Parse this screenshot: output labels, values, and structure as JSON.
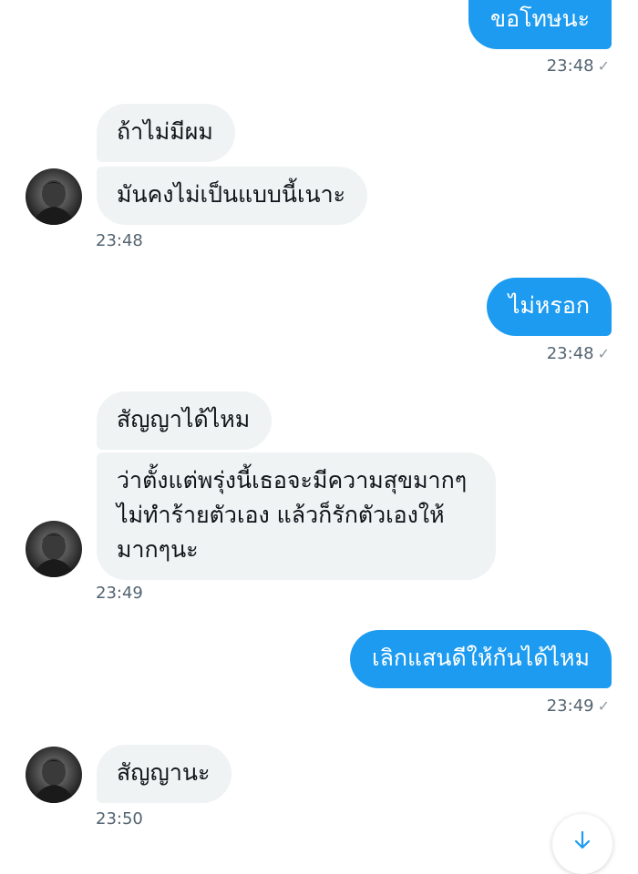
{
  "conversation": {
    "messages": [
      {
        "direction": "outgoing",
        "text": "ขอโทษนะ",
        "time": "23:48",
        "status_icon": "check-icon"
      },
      {
        "direction": "incoming",
        "lines": [
          "ถ้าไม่มีผม",
          "มันคงไม่เป็นแบบนี้เนาะ"
        ],
        "time": "23:48"
      },
      {
        "direction": "outgoing",
        "text": "ไม่หรอก",
        "time": "23:48",
        "status_icon": "check-icon"
      },
      {
        "direction": "incoming",
        "lines": [
          "สัญญาได้ไหม",
          "ว่าตั้งแต่พรุ่งนี้เธอจะมีความสุขมากๆ ไม่ทำร้ายตัวเอง แล้วก็รักตัวเองให้มากๆนะ"
        ],
        "time": "23:49"
      },
      {
        "direction": "outgoing",
        "text": "เลิกแสนดีให้กันได้ไหม",
        "time": "23:49",
        "status_icon": "check-icon"
      },
      {
        "direction": "incoming",
        "lines": [
          "สัญญานะ"
        ],
        "time": "23:50"
      }
    ]
  },
  "ui": {
    "check_glyph": "✓",
    "scroll_icon": "arrow-down-icon"
  },
  "colors": {
    "outgoing_bubble": "#1d9bf0",
    "incoming_bubble": "#eff3f4",
    "timestamp": "#536471"
  }
}
